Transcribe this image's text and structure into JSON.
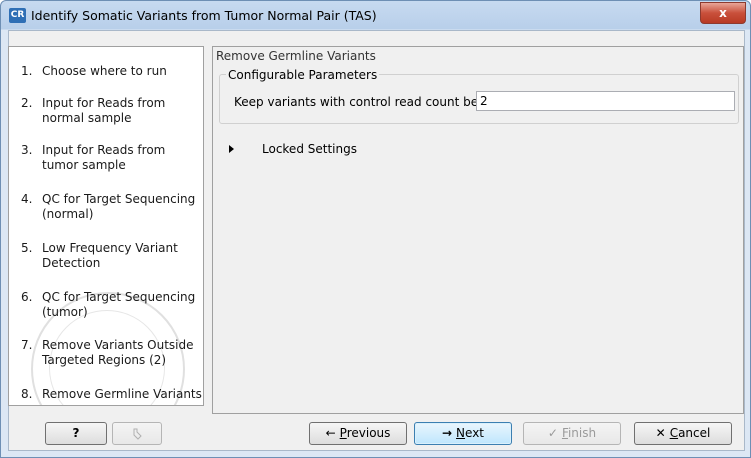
{
  "window": {
    "app_icon": "CR",
    "title": "Identify Somatic Variants from Tumor Normal Pair (TAS)",
    "close_label": "x"
  },
  "steps": [
    {
      "num": "1.",
      "label": "Choose where to run"
    },
    {
      "num": "2.",
      "label": "Input for Reads from normal sample"
    },
    {
      "num": "3.",
      "label": "Input for Reads from tumor sample"
    },
    {
      "num": "4.",
      "label": "QC for Target Sequencing (normal)"
    },
    {
      "num": "5.",
      "label": "Low Frequency Variant Detection"
    },
    {
      "num": "6.",
      "label": "QC for Target Sequencing (tumor)"
    },
    {
      "num": "7.",
      "label": "Remove Variants Outside Targeted Regions (2)"
    },
    {
      "num": "8.",
      "label": "Remove Germline Variants"
    }
  ],
  "panel": {
    "title": "Remove Germline Variants",
    "group_title": "Configurable Parameters",
    "param_label": "Keep variants with control read count below",
    "param_value": "2",
    "locked_label": "Locked Settings"
  },
  "buttons": {
    "help": "?",
    "reset_icon": "reset-icon",
    "previous_prefix": "",
    "previous_mnemonic": "P",
    "previous_rest": "revious",
    "next_mnemonic": "N",
    "next_rest": "ext",
    "finish_mnemonic": "F",
    "finish_rest": "inish",
    "cancel_mnemonic": "C",
    "cancel_rest": "ancel"
  },
  "colors": {
    "title_bar": "#c7daf0",
    "close_button": "#c9503b",
    "next_focus": "#bee6fd"
  }
}
